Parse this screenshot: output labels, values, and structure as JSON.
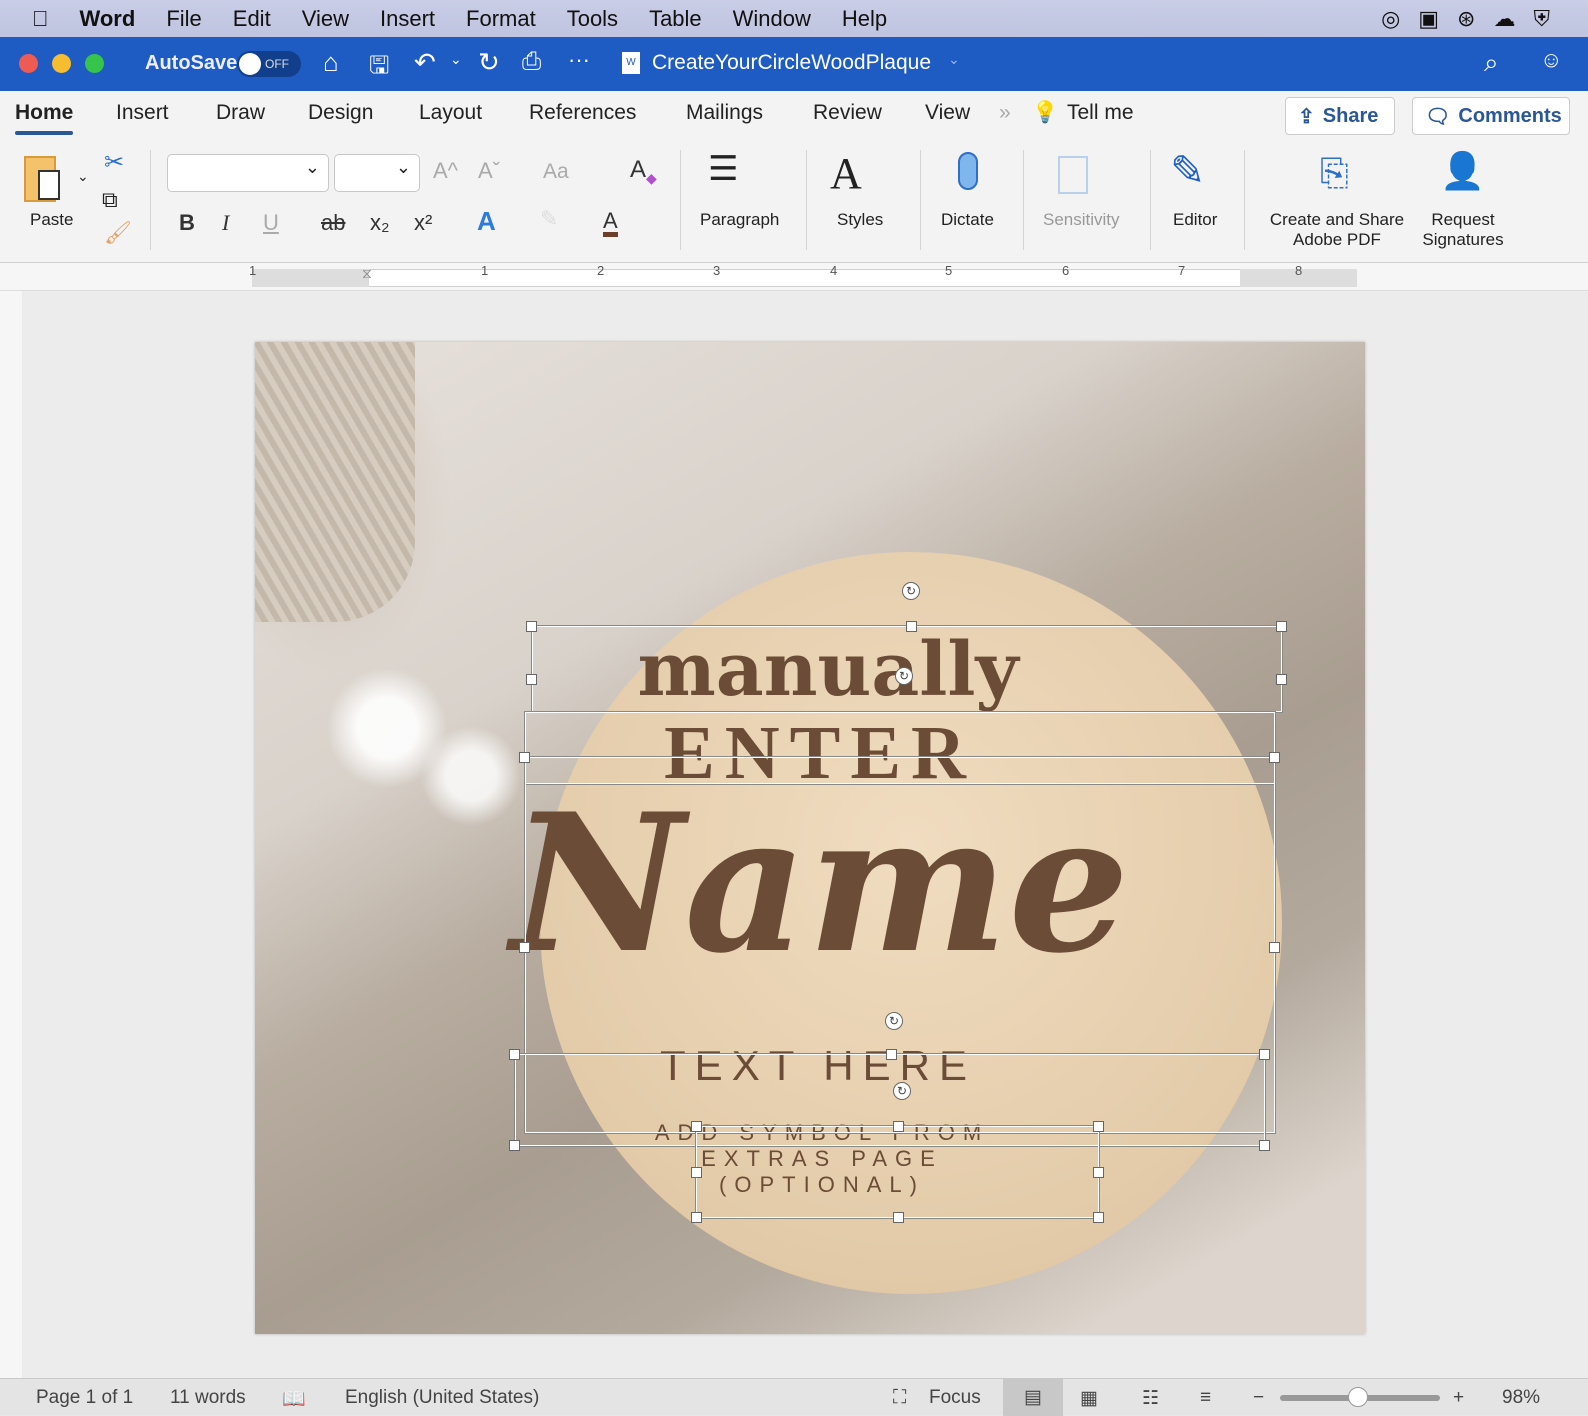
{
  "menubar": {
    "app": "Word",
    "items": [
      "File",
      "Edit",
      "View",
      "Insert",
      "Format",
      "Tools",
      "Table",
      "Window",
      "Help"
    ]
  },
  "titlebar": {
    "autosave_label": "AutoSave",
    "autosave_state": "OFF",
    "document_title": "CreateYourCircleWoodPlaque"
  },
  "tabs": {
    "items": [
      "Home",
      "Insert",
      "Draw",
      "Design",
      "Layout",
      "References",
      "Mailings",
      "Review",
      "View"
    ],
    "active": "Home",
    "tell_me": "Tell me",
    "share": "Share",
    "comments": "Comments"
  },
  "ribbon": {
    "paste": "Paste",
    "paragraph": "Paragraph",
    "styles": "Styles",
    "dictate": "Dictate",
    "sensitivity": "Sensitivity",
    "editor": "Editor",
    "adobe_line1": "Create and Share",
    "adobe_line2": "Adobe PDF",
    "sign_line1": "Request",
    "sign_line2": "Signatures",
    "bold": "B",
    "italic": "I",
    "underline": "U",
    "strike": "ab",
    "sub": "x₂",
    "sup": "x²",
    "grow": "A^",
    "shrink": "Aˇ",
    "case": "Aa"
  },
  "ruler": {
    "numbers": [
      "1",
      "1",
      "2",
      "3",
      "4",
      "5",
      "6",
      "7",
      "8"
    ]
  },
  "document": {
    "line1": "manually",
    "line2": "ENTER",
    "line3": "Name",
    "line4": "TEXT HERE",
    "line5": "ADD SYMBOL FROM",
    "line6": "EXTRAS PAGE",
    "line7": "(OPTIONAL)"
  },
  "status": {
    "page": "Page 1 of 1",
    "words": "11 words",
    "language": "English (United States)",
    "focus": "Focus",
    "zoom": "98%",
    "zoom_fraction": 0.49
  },
  "colors": {
    "titlebar": "#1e5bc3",
    "text_brown": "#6b4c36",
    "accent": "#2b5797"
  }
}
